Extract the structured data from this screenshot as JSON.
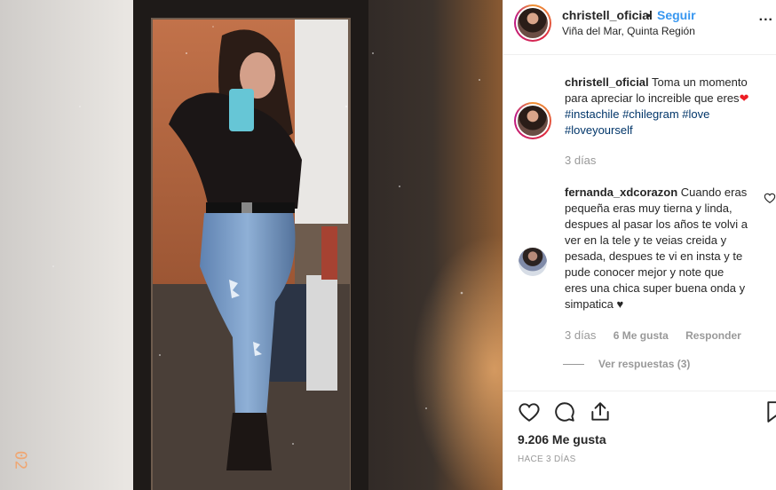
{
  "post": {
    "photo_alt": "Mirror selfie photo",
    "photo_timestamp_text": "02"
  },
  "header": {
    "username": "christell_oficial",
    "separator": "•",
    "follow_label": "Seguir",
    "location": "Viña del Mar, Quinta Región",
    "more_label": "..."
  },
  "caption": {
    "username": "christell_oficial",
    "text": "Toma un momento para apreciar lo increible que eres",
    "emoji": "❤",
    "hashtags": [
      "#instachile",
      "#chilegram",
      "#love",
      "#loveyourself"
    ],
    "time": "3 días"
  },
  "comment": {
    "username": "fernanda_xdcorazon",
    "text": "Cuando eras pequeña eras muy tierna y linda, despues al pasar los años te volvi a ver en la tele y te veias creida y pesada, despues te vi en insta y te pude conocer mejor y note que eres una chica super buena onda y simpatica",
    "emoji": "♥",
    "time": "3 días",
    "likes": "6 Me gusta",
    "reply_label": "Responder",
    "view_replies": "Ver respuestas (3)"
  },
  "footer": {
    "likes": "9.206 Me gusta",
    "date": "HACE 3 DÍAS"
  },
  "colors": {
    "link_blue": "#3897f0",
    "hashtag": "#003569",
    "muted": "#999999",
    "text": "#262626"
  }
}
